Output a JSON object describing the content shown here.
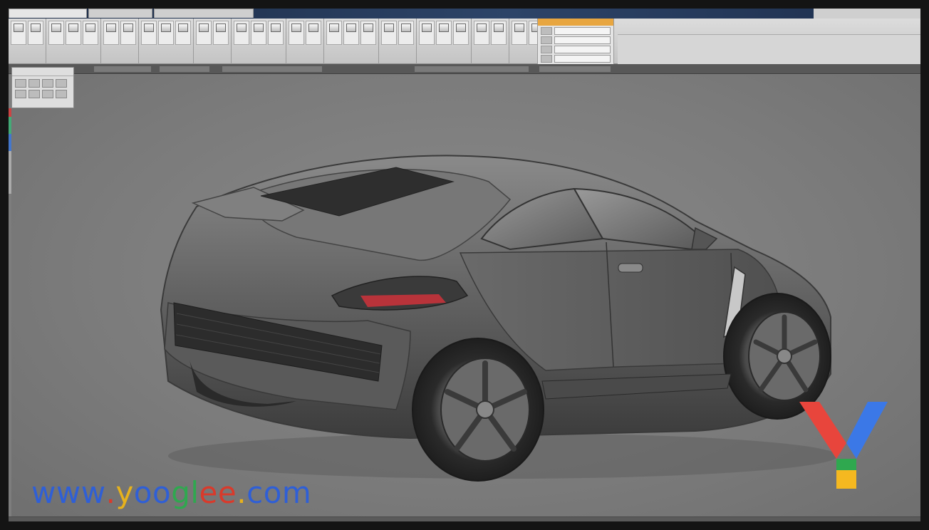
{
  "watermark": {
    "text": "www.yooglee.com",
    "letters": [
      {
        "ch": "w",
        "color": "#2f5fd6"
      },
      {
        "ch": "w",
        "color": "#2f5fd6"
      },
      {
        "ch": "w",
        "color": "#2f5fd6"
      },
      {
        "ch": ".",
        "color": "#d93a2b"
      },
      {
        "ch": "y",
        "color": "#e7b21c"
      },
      {
        "ch": "o",
        "color": "#2f5fd6"
      },
      {
        "ch": "o",
        "color": "#2f5fd6"
      },
      {
        "ch": "g",
        "color": "#2fa84f"
      },
      {
        "ch": "l",
        "color": "#2fa84f"
      },
      {
        "ch": "e",
        "color": "#d93a2b"
      },
      {
        "ch": "e",
        "color": "#d93a2b"
      },
      {
        "ch": ".",
        "color": "#e7b21c"
      },
      {
        "ch": "c",
        "color": "#2f5fd6"
      },
      {
        "ch": "o",
        "color": "#2f5fd6"
      },
      {
        "ch": "m",
        "color": "#2f5fd6"
      }
    ],
    "logo_colors": {
      "left": "#e8453c",
      "right": "#3b78e7",
      "stem_top": "#2fa84f",
      "stem_bottom": "#f5b820"
    }
  },
  "colors": {
    "viewport_bg": "#7d7d7d",
    "car_body": "#5e5e5e",
    "taillight": "#b8333a",
    "ribbon_bg": "#d0d0d0",
    "accent_panel": "#e8a640"
  },
  "icons": [
    "ribbon-tool-icon",
    "car-model-icon",
    "yooglee-logo-icon"
  ]
}
